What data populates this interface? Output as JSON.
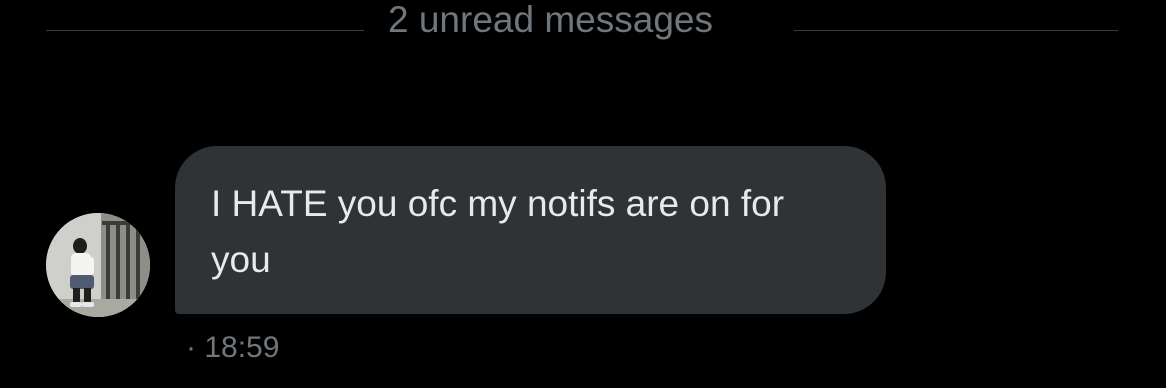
{
  "divider": {
    "label": "2 unread messages"
  },
  "message": {
    "text": "I HATE you ofc my notifs are on for you",
    "timestamp": "· 18:59"
  },
  "colors": {
    "background": "#000000",
    "bubble": "#2f3336",
    "message_text": "#e7e9ea",
    "muted_text": "#71767b"
  }
}
